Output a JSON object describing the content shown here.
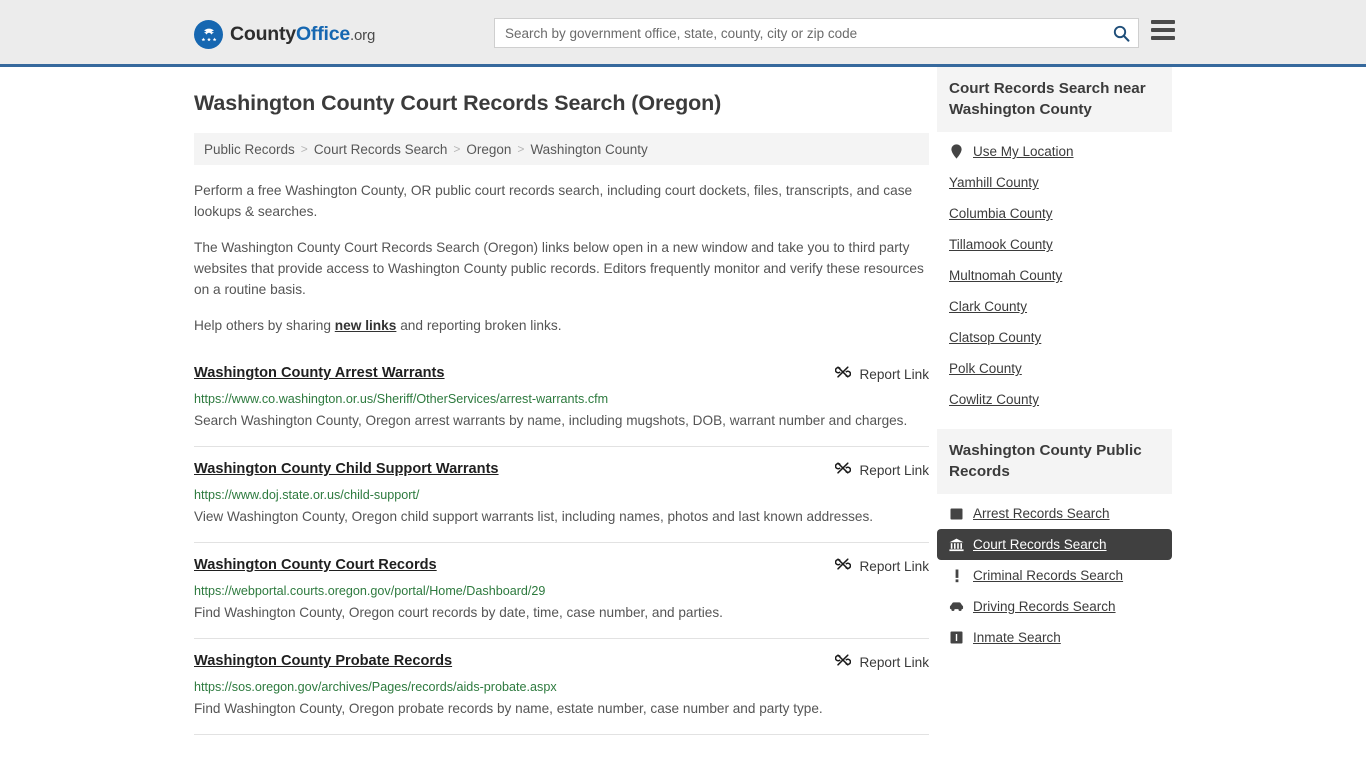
{
  "header": {
    "logo": {
      "part1": "County",
      "part2": "Office",
      "part3": ".org",
      "icon": "eagle-seal-icon"
    },
    "search": {
      "placeholder": "Search by government office, state, county, city or zip code",
      "value": "",
      "icon": "search-icon"
    },
    "menu_icon": "hamburger-menu-icon",
    "accent_color": "#36699d"
  },
  "page_title": "Washington County Court Records Search (Oregon)",
  "breadcrumb": {
    "separator": ">",
    "items": [
      {
        "label": "Public Records"
      },
      {
        "label": "Court Records Search"
      },
      {
        "label": "Oregon"
      },
      {
        "label": "Washington County"
      }
    ]
  },
  "intro": {
    "p1": "Perform a free Washington County, OR public court records search, including court dockets, files, transcripts, and case lookups & searches.",
    "p2": "The Washington County Court Records Search (Oregon) links below open in a new window and take you to third party websites that provide access to Washington County public records. Editors frequently monitor and verify these resources on a routine basis.",
    "p3_before": "Help others by sharing ",
    "p3_link": "new links",
    "p3_after": " and reporting broken links."
  },
  "report_link_label": "Report Link",
  "report_link_icon": "broken-link-icon",
  "results": [
    {
      "title": "Washington County Arrest Warrants",
      "url": "https://www.co.washington.or.us/Sheriff/OtherServices/arrest-warrants.cfm",
      "description": "Search Washington County, Oregon arrest warrants by name, including mugshots, DOB, warrant number and charges."
    },
    {
      "title": "Washington County Child Support Warrants",
      "url": "https://www.doj.state.or.us/child-support/",
      "description": "View Washington County, Oregon child support warrants list, including names, photos and last known addresses."
    },
    {
      "title": "Washington County Court Records",
      "url": "https://webportal.courts.oregon.gov/portal/Home/Dashboard/29",
      "description": "Find Washington County, Oregon court records by date, time, case number, and parties."
    },
    {
      "title": "Washington County Probate Records",
      "url": "https://sos.oregon.gov/archives/Pages/records/aids-probate.aspx",
      "description": "Find Washington County, Oregon probate records by name, estate number, case number and party type."
    }
  ],
  "sidebar": {
    "nearby": {
      "heading": "Court Records Search near Washington County",
      "items": [
        {
          "label": "Use My Location",
          "icon": "map-pin-icon"
        },
        {
          "label": "Yamhill County",
          "icon": ""
        },
        {
          "label": "Columbia County",
          "icon": ""
        },
        {
          "label": "Tillamook County",
          "icon": ""
        },
        {
          "label": "Multnomah County",
          "icon": ""
        },
        {
          "label": "Clark County",
          "icon": ""
        },
        {
          "label": "Clatsop County",
          "icon": ""
        },
        {
          "label": "Polk County",
          "icon": ""
        },
        {
          "label": "Cowlitz County",
          "icon": ""
        }
      ]
    },
    "public_records": {
      "heading": "Washington County Public Records",
      "items": [
        {
          "label": "Arrest Records Search",
          "icon": "id-card-icon",
          "active": false
        },
        {
          "label": "Court Records Search",
          "icon": "courthouse-icon",
          "active": true
        },
        {
          "label": "Criminal Records Search",
          "icon": "exclamation-icon",
          "active": false
        },
        {
          "label": "Driving Records Search",
          "icon": "car-icon",
          "active": false
        },
        {
          "label": "Inmate Search",
          "icon": "jail-icon",
          "active": false
        }
      ]
    }
  },
  "colors": {
    "header_bg": "#ececec",
    "accent_blue": "#36699d",
    "link_green": "#2d7a3e",
    "active_bg": "#404040"
  }
}
